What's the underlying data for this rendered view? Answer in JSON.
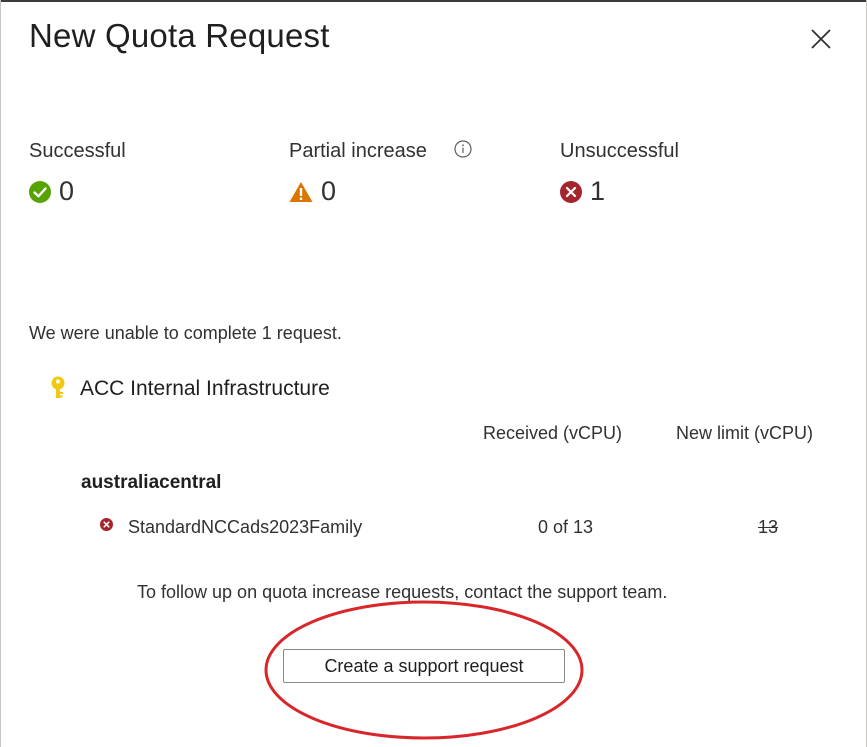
{
  "dialog": {
    "title": "New Quota Request"
  },
  "stats": {
    "successful": {
      "label": "Successful",
      "value": "0",
      "icon": "success-check-icon",
      "color": "#57a300"
    },
    "partial": {
      "label": "Partial increase",
      "value": "0",
      "icon": "warning-triangle-icon",
      "color": "#db7500"
    },
    "unsuccessful": {
      "label": "Unsuccessful",
      "value": "1",
      "icon": "error-x-icon",
      "color": "#a4262c"
    }
  },
  "message": "We were unable to complete 1 request.",
  "subscription": {
    "name": "ACC Internal Infrastructure",
    "icon": "key-icon",
    "icon_color": "#f2c811"
  },
  "table": {
    "headers": [
      "Received (vCPU)",
      "New limit (vCPU)"
    ],
    "region": "australiacentral",
    "rows": [
      {
        "family": "StandardNCCads2023Family",
        "received": "0 of 13",
        "new_limit": "13",
        "status_icon": "error-x-icon"
      }
    ]
  },
  "followup_text": "To follow up on quota increase requests, contact the support team.",
  "support_button_label": "Create a support request",
  "annotation_color": "#d9262b"
}
